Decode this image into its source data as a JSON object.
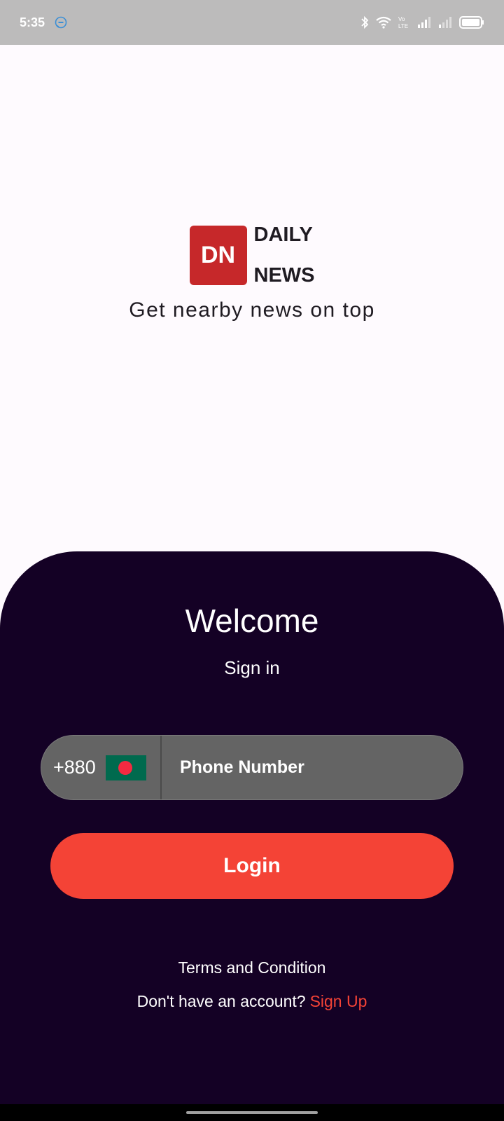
{
  "status_bar": {
    "time": "5:35",
    "icons": [
      "messenger-icon",
      "bluetooth-icon",
      "wifi-icon",
      "volte-icon",
      "signal-icon",
      "signal-icon",
      "battery-icon"
    ],
    "volte_label_top": "Vo",
    "volte_label_bottom": "LTE"
  },
  "logo": {
    "badge": "DN",
    "line1": "DAILY",
    "line2": "NEWS",
    "color": "#c6282a"
  },
  "tagline": "Get nearby news on top",
  "login_panel": {
    "title": "Welcome",
    "subtitle": "Sign in",
    "country_code": "+880",
    "flag": "bangladesh-flag",
    "phone_placeholder": "Phone Number",
    "login_label": "Login",
    "terms_label": "Terms and Condition",
    "no_account_text": "Don't have an account?",
    "signup_label": "Sign Up",
    "accent_color": "#f44336",
    "background_color": "#140125"
  }
}
